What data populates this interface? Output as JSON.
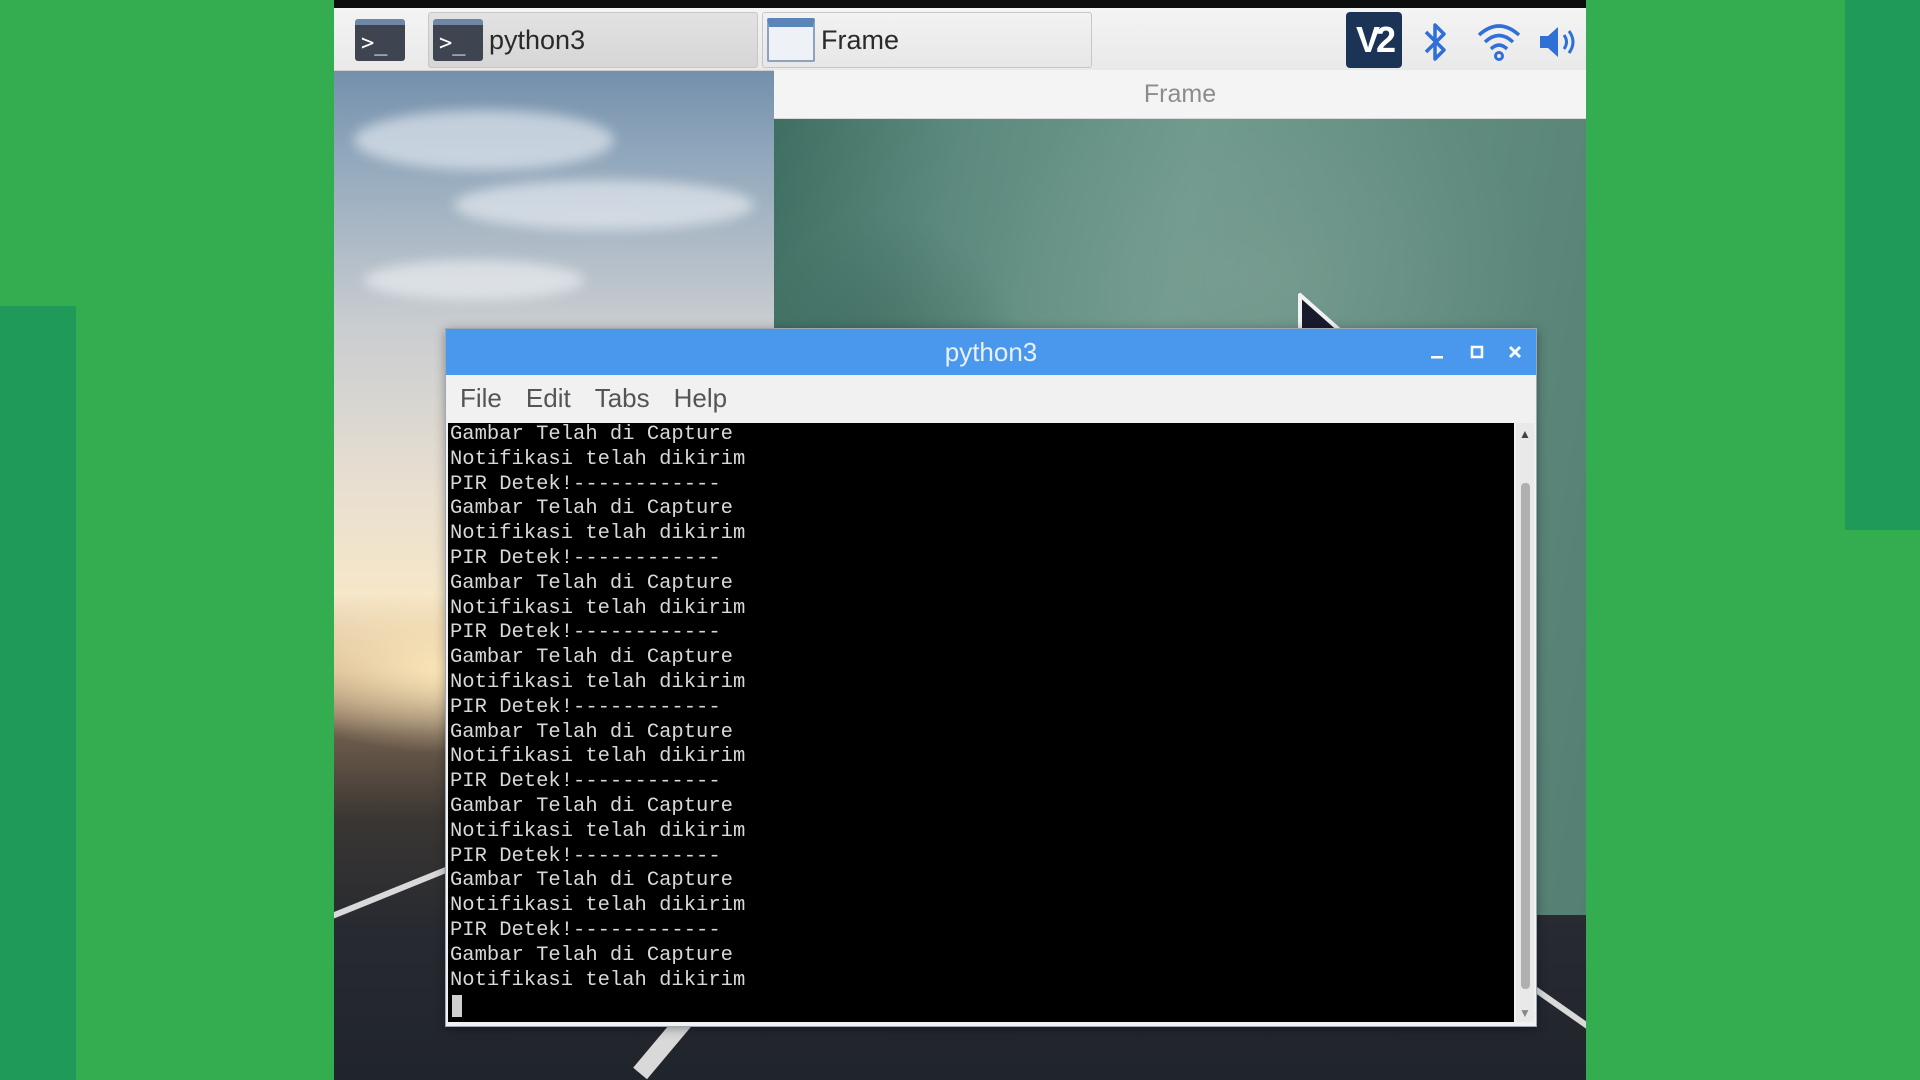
{
  "taskbar": {
    "tasks": [
      {
        "label": "python3"
      },
      {
        "label": "Frame"
      }
    ],
    "tray": {
      "vnc_text": "V2"
    }
  },
  "frame_window": {
    "title": "Frame"
  },
  "terminal_window": {
    "title": "python3",
    "menu": [
      "File",
      "Edit",
      "Tabs",
      "Help"
    ],
    "lines": [
      "Gambar Telah di Capture",
      "Notifikasi telah dikirim",
      "PIR Detek!------------",
      "Gambar Telah di Capture",
      "Notifikasi telah dikirim",
      "PIR Detek!------------",
      "Gambar Telah di Capture",
      "Notifikasi telah dikirim",
      "PIR Detek!------------",
      "Gambar Telah di Capture",
      "Notifikasi telah dikirim",
      "PIR Detek!------------",
      "Gambar Telah di Capture",
      "Notifikasi telah dikirim",
      "PIR Detek!------------",
      "Gambar Telah di Capture",
      "Notifikasi telah dikirim",
      "PIR Detek!------------",
      "Gambar Telah di Capture",
      "Notifikasi telah dikirim",
      "PIR Detek!------------",
      "Gambar Telah di Capture",
      "Notifikasi telah dikirim"
    ]
  },
  "colors": {
    "background_green": "#33ad4f",
    "titlebar_blue": "#4a97ee",
    "terminal_bg": "#000000"
  }
}
